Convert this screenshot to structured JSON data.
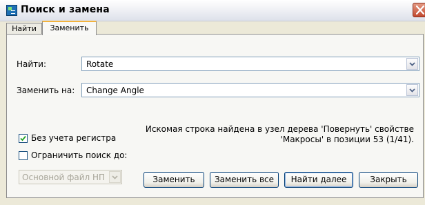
{
  "window": {
    "title": "Поиск и замена"
  },
  "tabs": [
    {
      "label": "Найти"
    },
    {
      "label": "Заменить"
    }
  ],
  "find": {
    "label": "Найти:",
    "value": "Rotate"
  },
  "replace": {
    "label": "Заменить на:",
    "value": "Change Angle"
  },
  "options": {
    "ignore_case": {
      "label": "Без учета регистра",
      "checked": true
    },
    "limit_search": {
      "label": "Ограничить поиск до:",
      "checked": false
    },
    "scope_value": "Основной файл НП"
  },
  "status": {
    "line1": "Искомая строка найдена в узел дерева 'Повернуть' свойстве",
    "line2": "'Макросы' в позиции 53 (1/41)."
  },
  "buttons": {
    "replace": "Заменить",
    "replace_all": "Заменить все",
    "find_next": "Найти далее",
    "close": "Закрыть"
  }
}
